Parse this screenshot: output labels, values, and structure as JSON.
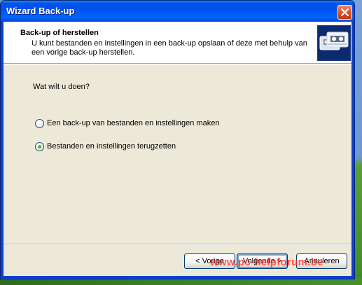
{
  "window": {
    "title": "Wizard Back-up",
    "close_icon": "close-x-icon"
  },
  "header": {
    "title": "Back-up of herstellen",
    "description": "U kunt bestanden en instellingen in een back-up opslaan of deze met behulp van een vorige back-up herstellen.",
    "icon": "backup-tape-drive-icon"
  },
  "body": {
    "question": "Wat wilt u doen?",
    "options": [
      {
        "label": "Een back-up van bestanden en instellingen maken",
        "checked": false
      },
      {
        "label": "Bestanden en instellingen terugzetten",
        "checked": true
      }
    ]
  },
  "buttons": {
    "back": "< Vorige",
    "next": "Volgende >",
    "cancel": "Annuleren"
  },
  "watermark": "www.pc-helpforum.be",
  "colors": {
    "title_bar": "#0053ee",
    "dialog_background": "#ece9d8",
    "radio_checked": "#21a121",
    "watermark": "#ff2828"
  }
}
